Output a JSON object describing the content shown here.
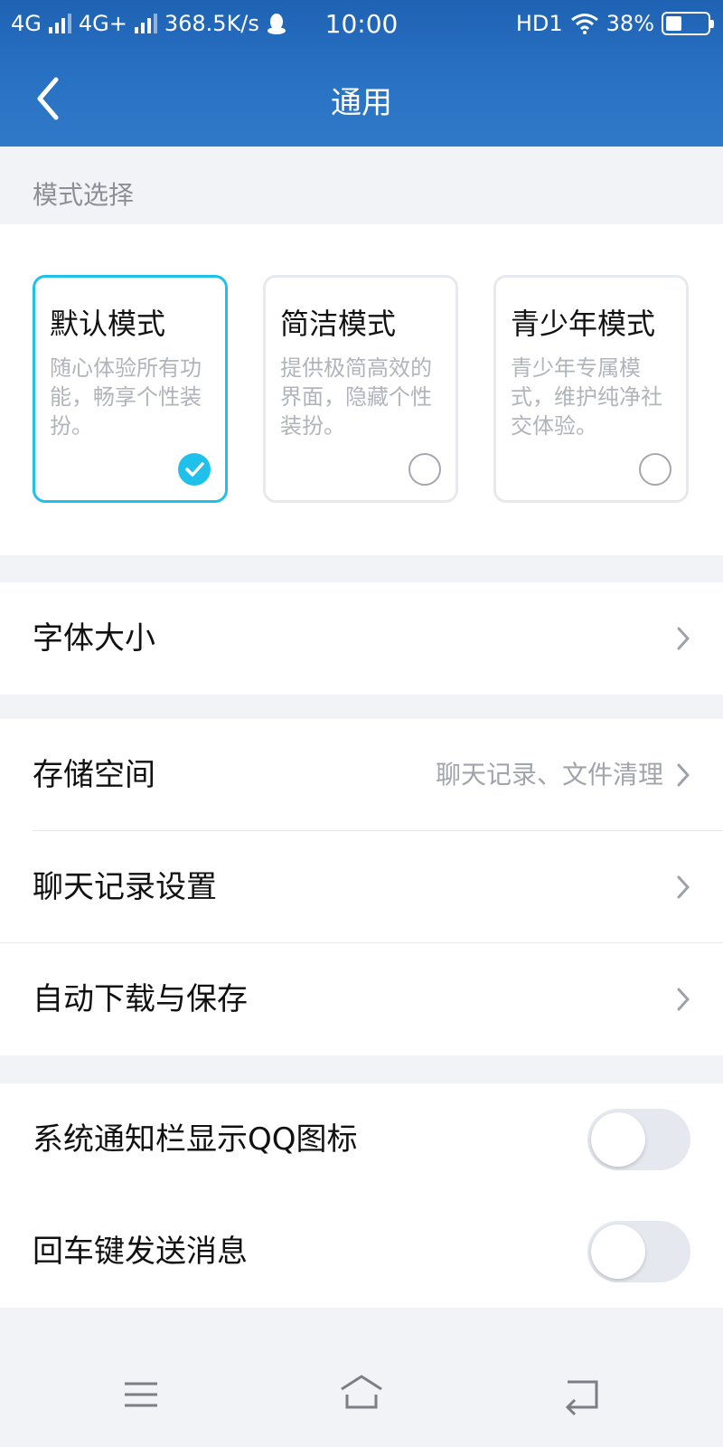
{
  "status_bar": {
    "net1": "4G",
    "net2": "4G+",
    "speed": "368.5K/s",
    "time": "10:00",
    "hd": "HD1",
    "battery": "38%",
    "battery_level": 0.38
  },
  "header": {
    "title": "通用"
  },
  "mode_section": {
    "label": "模式选择",
    "modes": [
      {
        "title": "默认模式",
        "desc": "随心体验所有功能，畅享个性装扮。",
        "selected": true
      },
      {
        "title": "简洁模式",
        "desc": "提供极简高效的界面，隐藏个性装扮。",
        "selected": false
      },
      {
        "title": "青少年模式",
        "desc": "青少年专属模式，维护纯净社交体验。",
        "selected": false
      }
    ]
  },
  "settings": {
    "font_size": "字体大小",
    "storage": {
      "label": "存储空间",
      "value": "聊天记录、文件清理"
    },
    "chat_history": "聊天记录设置",
    "auto_download": "自动下载与保存",
    "show_qq_icon": {
      "label": "系统通知栏显示QQ图标",
      "on": false
    },
    "enter_send": {
      "label": "回车键发送消息",
      "on": false
    }
  },
  "colors": {
    "header": "#2a6fbe",
    "accent": "#1fc1ea",
    "background": "#f2f3f7"
  },
  "nav": {
    "menu_icon": "menu-icon",
    "home_icon": "home-icon",
    "back_icon": "back-nav-icon"
  }
}
